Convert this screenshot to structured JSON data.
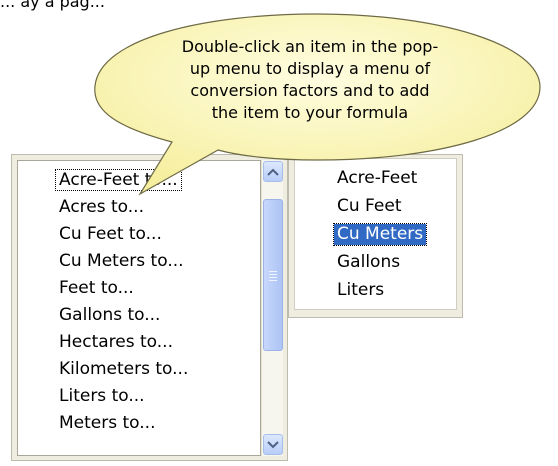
{
  "page": {
    "top_text": "... ay a pag..."
  },
  "tooltip": {
    "text": "Double-click an item in the pop-up menu to display a menu of conversion factors and to add the item to your formula",
    "lines": [
      "Double-click an item in the pop-",
      "up menu to display a menu of",
      "conversion factors and to add",
      "the item to your formula"
    ],
    "fill_color": "#fbf7b8"
  },
  "conversion_list": {
    "items": [
      "Acre-Feet to...",
      "Acres to...",
      "Cu Feet to...",
      "Cu Meters to...",
      "Feet to...",
      "Gallons to...",
      "Hectares to...",
      "Kilometers to...",
      "Liters to...",
      "Meters to..."
    ],
    "focused_item": "Acre-Feet to..."
  },
  "target_list": {
    "items": [
      "Acre-Feet",
      "Cu Feet",
      "Cu Meters",
      "Gallons",
      "Liters"
    ],
    "selected": "Cu Meters",
    "selection_color": "#316ac5"
  },
  "icons": {
    "scroll_up": "chevron-up-icon",
    "scroll_down": "chevron-down-icon",
    "scroll_grip": "grip-icon"
  }
}
